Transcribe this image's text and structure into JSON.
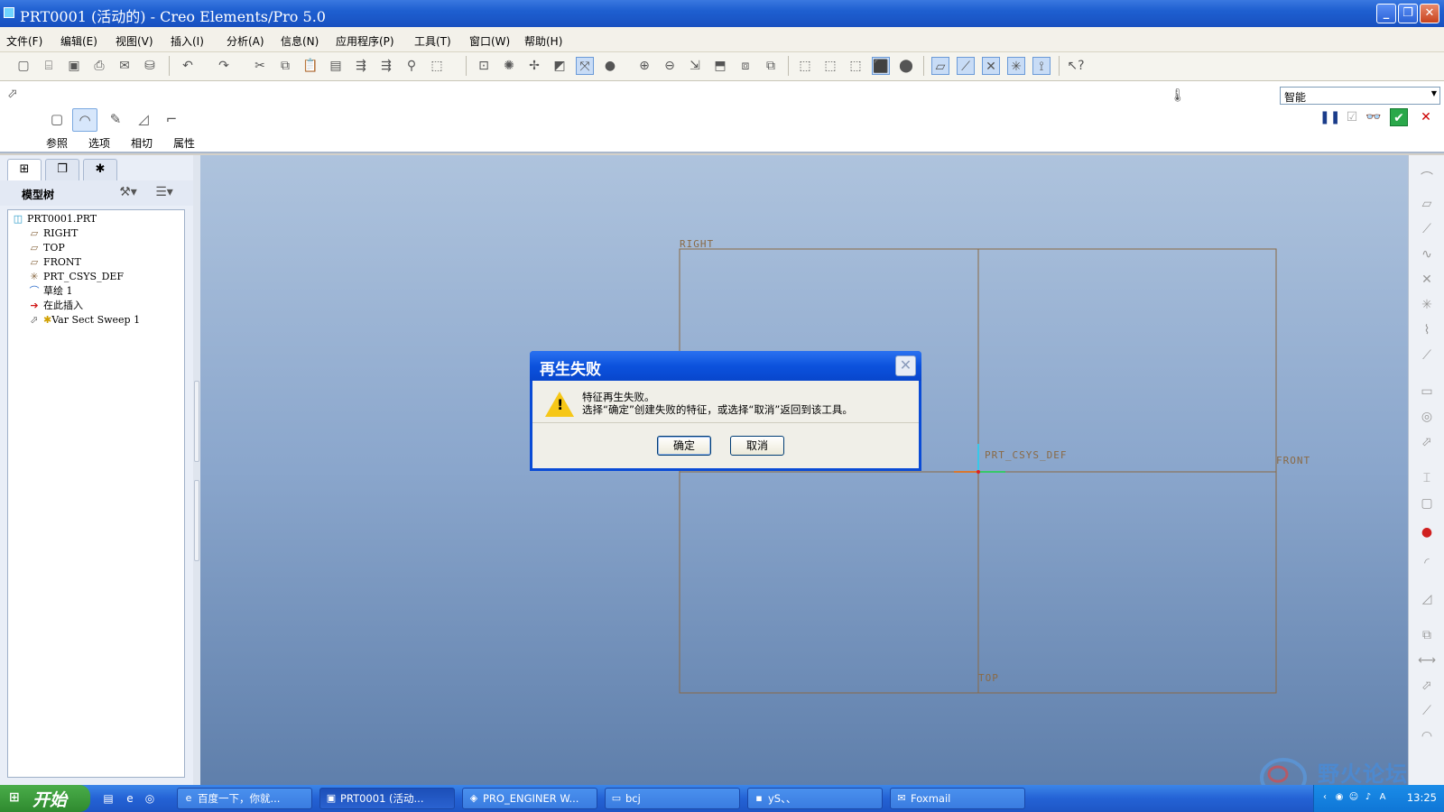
{
  "window": {
    "title": "PRT0001 (活动的) - Creo Elements/Pro 5.0"
  },
  "menu": [
    "文件(F)",
    "编辑(E)",
    "视图(V)",
    "插入(I)",
    "分析(A)",
    "信息(N)",
    "应用程序(P)",
    "工具(T)",
    "窗口(W)",
    "帮助(H)"
  ],
  "dashboard": {
    "tabs": [
      "参照",
      "选项",
      "相切",
      "属性"
    ],
    "filter_value": "智能"
  },
  "model_tree": {
    "title": "模型树",
    "items": [
      {
        "label": "PRT0001.PRT",
        "icon": "part-icon"
      },
      {
        "label": "RIGHT",
        "icon": "datum-plane-icon"
      },
      {
        "label": "TOP",
        "icon": "datum-plane-icon"
      },
      {
        "label": "FRONT",
        "icon": "datum-plane-icon"
      },
      {
        "label": "PRT_CSYS_DEF",
        "icon": "csys-icon"
      },
      {
        "label": "草绘 1",
        "icon": "sketch-icon"
      },
      {
        "label": "在此插入",
        "icon": "insert-here-arrow-icon"
      },
      {
        "label": "Var Sect Sweep 1",
        "icon": "sweep-feature-icon"
      }
    ]
  },
  "graphics": {
    "labels": {
      "right": "RIGHT",
      "front": "FRONT",
      "top": "TOP",
      "csys": "PRT_CSYS_DEF"
    }
  },
  "dialog": {
    "title": "再生失败",
    "line1": "特征再生失败。",
    "line2": "选择“确定”创建失败的特征，或选择“取消”返回到该工具。",
    "ok": "确定",
    "cancel": "取消"
  },
  "taskbar": {
    "start": "开始",
    "tasks": [
      {
        "label": "百度一下，你就...",
        "icon": "ie-icon"
      },
      {
        "label": "PRT0001 (活动...",
        "icon": "creo-icon"
      },
      {
        "label": "PRO_ENGINER W...",
        "icon": "browser-icon"
      },
      {
        "label": "bcj",
        "icon": "folder-icon"
      },
      {
        "label": "yS、、",
        "icon": "app-icon"
      },
      {
        "label": "Foxmail",
        "icon": "foxmail-icon"
      }
    ],
    "clock": "13:25"
  },
  "watermark": {
    "text": "野火论坛"
  },
  "colors": {
    "title_blue": "#1e5fd0",
    "datum_brown": "#8a6a45",
    "graphics_top": "#aec3dd",
    "graphics_bottom": "#5f7fab"
  }
}
